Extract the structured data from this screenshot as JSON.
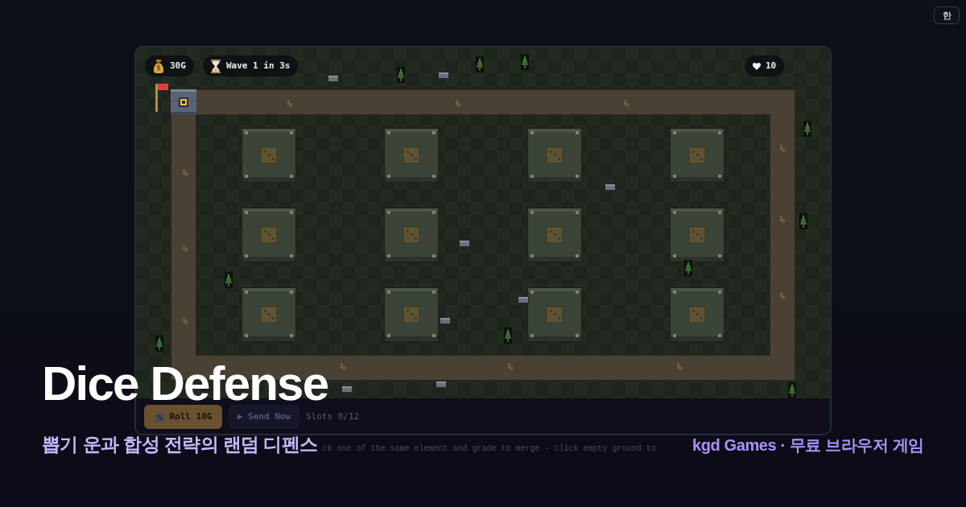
{
  "language_toggle": {
    "label": "한"
  },
  "hud": {
    "gold": "30G",
    "wave": "Wave 1 in 3s",
    "lives": "10"
  },
  "controls": {
    "roll_button": "Roll 10G",
    "send_button": "▶ Send Now",
    "slots": "Slots 0/12"
  },
  "hint": "ck one of the same element and grade to merge · Click empty ground to",
  "promo": {
    "title": "Dice Defense",
    "subtitle": "뽑기 운과 합성 전략의 랜덤 디펜스",
    "credit": "kgd Games · 무료 브라우저 게임"
  }
}
